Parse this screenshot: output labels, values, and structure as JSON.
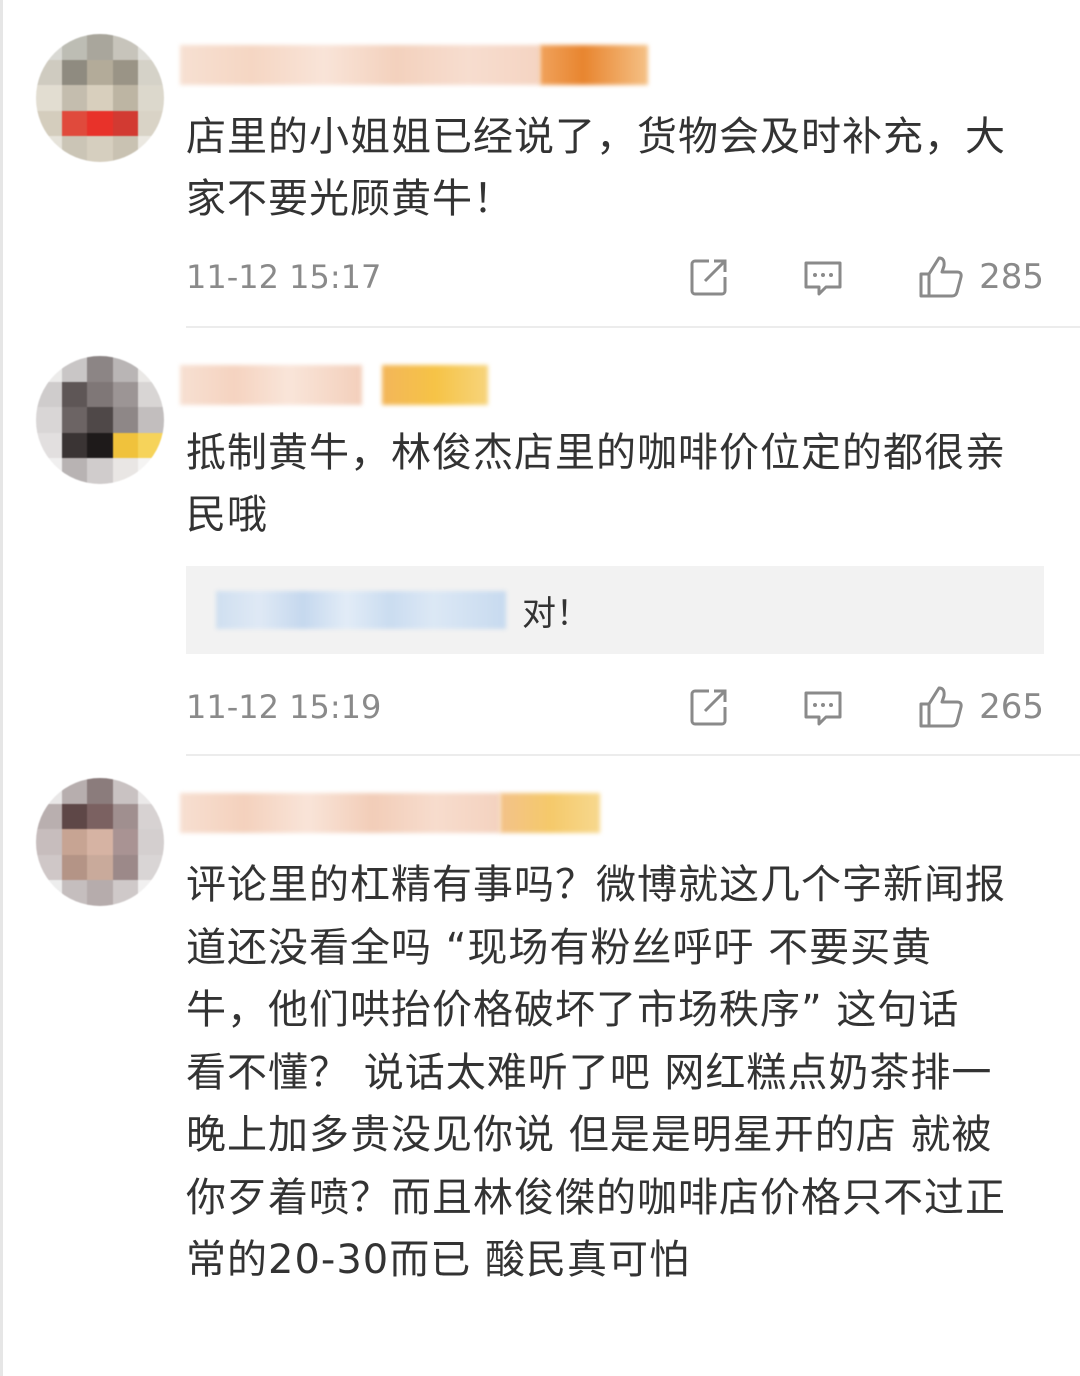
{
  "comments": [
    {
      "text": "店里的小姐姐已经说了，货物会及时补充，大家不要光顾黄牛！",
      "time": "11-12 15:17",
      "likes": "285",
      "avatar_icon": "pixelated-avatar",
      "name_blurred": true
    },
    {
      "text": "抵制黄牛，林俊杰店里的咖啡价位定的都很亲民哦",
      "time": "11-12 15:19",
      "likes": "265",
      "avatar_icon": "pixelated-avatar",
      "name_blurred": true,
      "reply": {
        "text": "对！",
        "name_blurred": true
      }
    },
    {
      "text": "评论里的杠精有事吗？微博就这几个字新闻报道还没看全吗 “现场有粉丝呼吁 不要买黄牛，他们哄抬价格破坏了市场秩序” 这句话 看不懂？ 说话太难听了吧 网红糕点奶茶排一晚上加多贵没见你说 但是是明星开的店 就被你歹着喷？而且林俊傑的咖啡店价格只不过正常的20-30而已 酸民真可怕",
      "avatar_icon": "pixelated-avatar",
      "name_blurred": true
    }
  ],
  "icons": {
    "share": "share-icon",
    "comment": "comment-icon",
    "like": "thumbs-up-icon"
  },
  "colors": {
    "text": "#333333",
    "meta": "#8a8a8a",
    "reply_bg": "#f2f2f2",
    "divider": "#ececec"
  }
}
